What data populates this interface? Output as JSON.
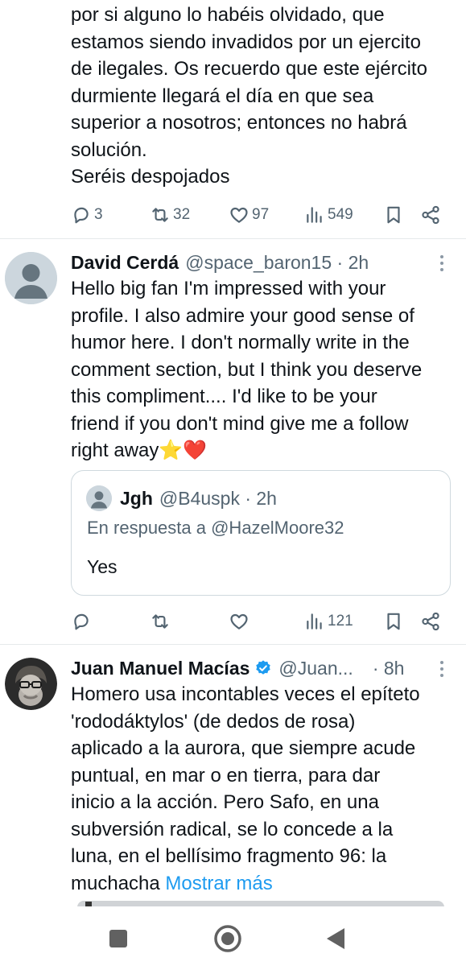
{
  "tweets": [
    {
      "text": "por si alguno lo habéis olvidado, que\nestamos siendo invadidos por un ejercito\nde ilegales. Os recuerdo que este ejército\ndurmiente llegará el día en que sea\nsuperior a nosotros; entonces no habrá\nsolución.\nSeréis despojados",
      "actions": {
        "replies": "3",
        "reposts": "32",
        "likes": "97",
        "views": "549"
      }
    },
    {
      "name": "David Cerdá",
      "handle": "@space_baron15 · 2h",
      "text": "Hello big fan I'm impressed with your\nprofile. I also admire your good sense of\nhumor here. I don't normally write in the\ncomment section, but I think you deserve\nthis compliment.... I'd like to be your\nfriend if you don't mind give me a follow\nright away⭐❤️",
      "quote": {
        "name": "Jgh",
        "handle": "@B4uspk · 2h",
        "reply_to": "En respuesta a @HazelMoore32",
        "text": "Yes"
      },
      "actions": {
        "replies": "",
        "reposts": "",
        "likes": "",
        "views": "121"
      }
    },
    {
      "name": "Juan Manuel Macías",
      "handle": "@Juan...",
      "time": "· 8h",
      "text": "Homero usa incontables veces el epíteto\n'rododáktylos' (de dedos de rosa)\naplicado a la aurora, que siempre acude\npuntual, en mar o en tierra, para dar\ninicio a la acción. Pero Safo, en una\nsubversión radical, se lo concede a la\nluna, en el bellísimo fragmento 96: la\nmuchacha ",
      "show_more": "Mostrar más"
    }
  ],
  "icons": {
    "reply": "reply-icon",
    "repost": "repost-icon",
    "like": "like-icon",
    "views": "views-icon",
    "bookmark": "bookmark-icon",
    "share": "share-icon",
    "more": "more-icon",
    "verified": "verified-badge-icon",
    "nav_recents": "recents-square-icon",
    "nav_home": "home-circle-icon",
    "nav_back": "back-triangle-icon"
  },
  "colors": {
    "link": "#1d9bf0",
    "secondary": "#536471",
    "verified": "#1d9bf0"
  }
}
